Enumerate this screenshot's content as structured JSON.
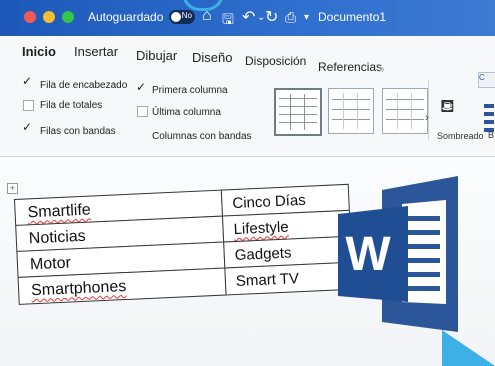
{
  "title_bar": {
    "autosave_label": "Autoguardado",
    "autosave_state": "No",
    "document_title": "Documento1",
    "icons": [
      "home-icon",
      "save-icon",
      "undo-icon",
      "redo-icon",
      "print-icon",
      "customize-icon"
    ]
  },
  "ribbon": {
    "tabs": [
      "Inicio",
      "Insertar",
      "Dibujar",
      "Diseño",
      "Disposición",
      "Referencias"
    ],
    "more": "»",
    "options": {
      "header_row": "Fila de encabezado",
      "total_row": "Fila de totales",
      "banded_rows": "Filas con bandas",
      "first_column": "Primera columna",
      "last_column": "Última columna",
      "banded_columns": "Columnas con bandas"
    },
    "checked": {
      "header_row": true,
      "total_row": false,
      "banded_rows": true,
      "first_column": true,
      "last_column": false,
      "banded_columns": false
    },
    "shading_label": "Sombreado",
    "edge_label": "B",
    "edge_button": "C"
  },
  "document": {
    "table": [
      [
        "Smartlife",
        "Cinco Días"
      ],
      [
        "Noticias",
        "Lifestyle"
      ],
      [
        "Motor",
        "Gadgets"
      ],
      [
        "Smartphones",
        "Smart TV"
      ]
    ],
    "logo_letter": "W"
  },
  "colors": {
    "title_bar": "#2b62c2",
    "word_blue": "#2b579a",
    "accent_cyan": "#3db1e6"
  }
}
